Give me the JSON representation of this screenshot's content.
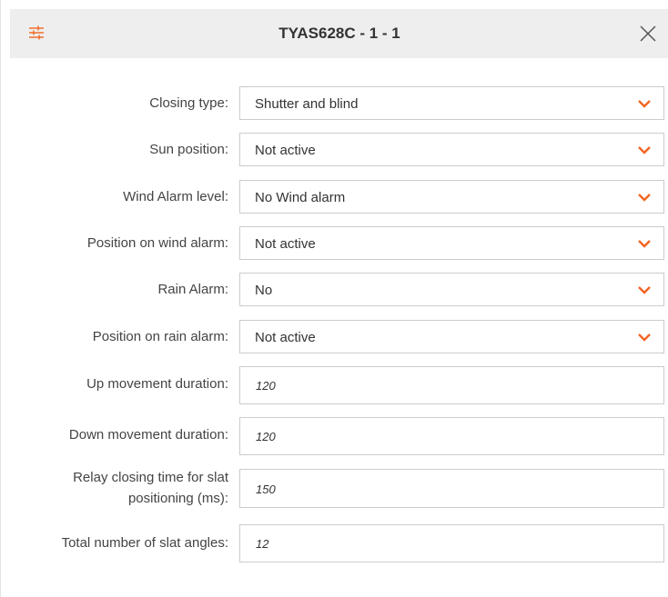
{
  "dialog": {
    "title": "TYAS628C - 1 - 1",
    "settings_icon": "sliders-icon",
    "close_icon": "close-icon",
    "accent_color": "#f26522"
  },
  "fields": [
    {
      "label": "Closing type:",
      "type": "select",
      "value": "Shutter and blind"
    },
    {
      "label": "Sun position:",
      "type": "select",
      "value": "Not active"
    },
    {
      "label": "Wind Alarm level:",
      "type": "select",
      "value": "No Wind alarm"
    },
    {
      "label": "Position on wind alarm:",
      "type": "select",
      "value": "Not active"
    },
    {
      "label": "Rain Alarm:",
      "type": "select",
      "value": "No"
    },
    {
      "label": "Position on rain alarm:",
      "type": "select",
      "value": "Not active"
    },
    {
      "label": "Up movement duration:",
      "type": "number",
      "value": "120"
    },
    {
      "label": "Down movement duration:",
      "type": "number",
      "value": "120"
    },
    {
      "label_line1": "Relay closing time for slat",
      "label_line2": "positioning (ms):",
      "type": "number",
      "value": "150"
    },
    {
      "label": "Total number of slat angles:",
      "type": "number",
      "value": "12"
    }
  ]
}
